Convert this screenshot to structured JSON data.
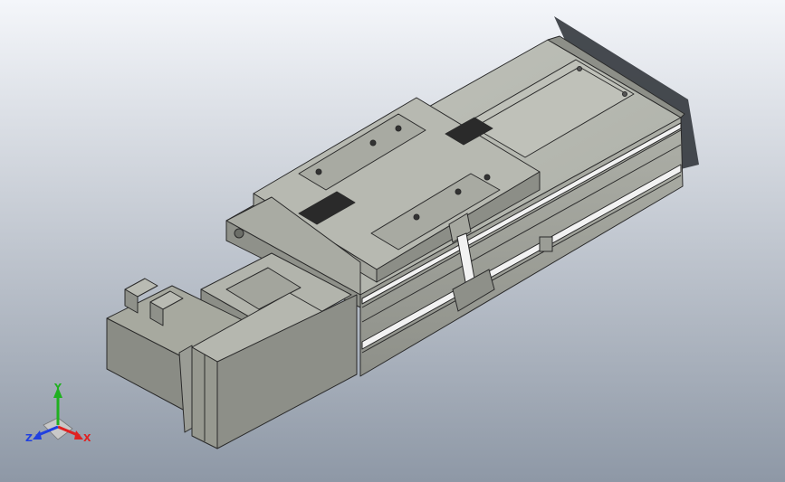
{
  "colors": {
    "bg_top": "#f4f6fa",
    "bg_bottom": "#8e98a6",
    "body_light": "#b9bbb3",
    "body_mid": "#9fa29a",
    "body_dark": "#7d7f78",
    "edge": "#2a2a2a",
    "shadow": "#33373d",
    "rail": "#f2f2f2",
    "axis_x": "#e02020",
    "axis_y": "#20b020",
    "axis_z": "#2040e0"
  },
  "axis_triad": {
    "x_label": "X",
    "y_label": "Y",
    "z_label": "Z"
  },
  "icons": [
    "axis-triad-icon"
  ]
}
